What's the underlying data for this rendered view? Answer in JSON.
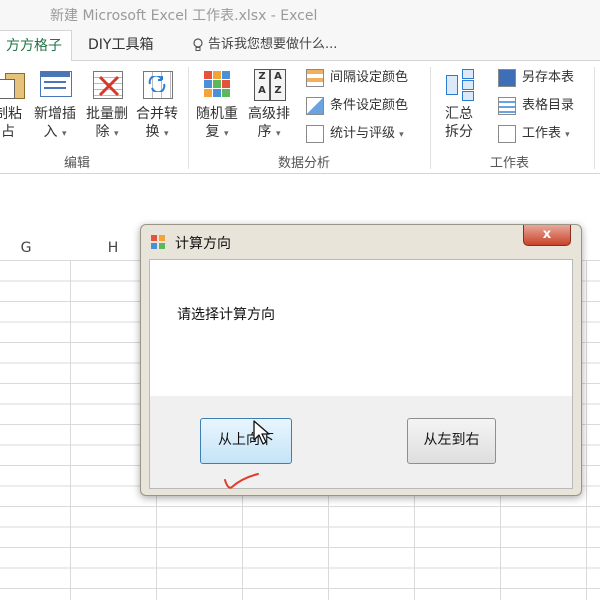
{
  "window": {
    "title": "新建 Microsoft Excel 工作表.xlsx  -  Excel"
  },
  "tabs": {
    "active": "方方格子",
    "diy": "DIY工具箱",
    "tell_me": "告诉我您想要做什么..."
  },
  "ribbon": {
    "buttons": [
      {
        "label1": "制粘",
        "label2": "占"
      },
      {
        "label1": "新增插",
        "label2": "入"
      },
      {
        "label1": "批量删",
        "label2": "除"
      },
      {
        "label1": "合并转",
        "label2": "换"
      },
      {
        "label1": "随机重",
        "label2": "复"
      },
      {
        "label1": "高级排",
        "label2": "序"
      },
      {
        "label1": "汇总",
        "label2": "拆分"
      }
    ],
    "small_items": [
      "间隔设定颜色",
      "条件设定颜色",
      "统计与评级",
      "另存本表",
      "表格目录",
      "工作表"
    ],
    "groups": [
      "编辑",
      "数据分析",
      "工作表"
    ]
  },
  "sheet": {
    "columns": [
      "G",
      "H"
    ]
  },
  "dialog": {
    "title": "计算方向",
    "close": "x",
    "prompt": "请选择计算方向",
    "button_top_down": "从上向下",
    "button_left_right": "从左到右"
  },
  "colors": {
    "excel_green": "#217346",
    "close_red": "#c9432b",
    "annotation_red": "#e33b2e"
  }
}
